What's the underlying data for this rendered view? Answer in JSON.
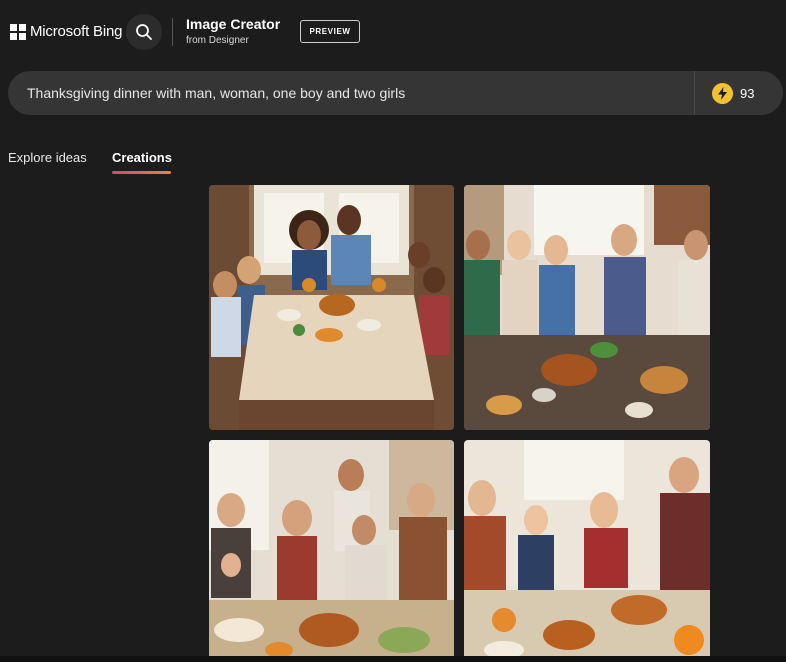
{
  "header": {
    "brand": "Microsoft Bing",
    "app_title": "Image Creator",
    "app_subtitle": "from Designer",
    "badge": "PREVIEW"
  },
  "prompt": {
    "value": "Thanksgiving dinner with man, woman, one boy and two girls",
    "boosts": "93"
  },
  "tabs": [
    {
      "label": "Explore ideas",
      "active": false
    },
    {
      "label": "Creations",
      "active": true
    }
  ],
  "images": [
    {
      "name": "creation-image-1"
    },
    {
      "name": "creation-image-2"
    },
    {
      "name": "creation-image-3"
    },
    {
      "name": "creation-image-4"
    }
  ],
  "colors": {
    "background": "#1c1c1c",
    "prompt_bar": "#353535",
    "boost_icon": "#f2c12e",
    "tab_underline_start": "#d9456f",
    "tab_underline_end": "#f0813a"
  }
}
